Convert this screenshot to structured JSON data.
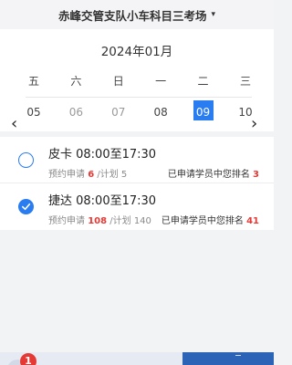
{
  "header": {
    "title": "赤峰交管支队小车科目三考场",
    "caret": "▾"
  },
  "calendar": {
    "month": "2024年01月",
    "weekdays": [
      "五",
      "六",
      "日",
      "一",
      "二",
      "三"
    ],
    "dates": [
      "05",
      "06",
      "07",
      "08",
      "09",
      "10"
    ],
    "selected_date": "09",
    "prev_arrow": "‹",
    "next_arrow": "›"
  },
  "slots": [
    {
      "name": "皮卡 08:00至17:30",
      "applied_label": "预约申请",
      "applied_value": "6",
      "plan_label": "/计划",
      "plan_value": "5",
      "rank_label": "已申请学员中您排名",
      "rank_value": "3",
      "checked": false
    },
    {
      "name": "捷达 08:00至17:30",
      "applied_label": "预约申请",
      "applied_value": "108",
      "plan_label": "/计划",
      "plan_value": "140",
      "rank_label": "已申请学员中您排名",
      "rank_value": "41",
      "checked": true
    }
  ],
  "bottom": {
    "badge_count": "1"
  },
  "colors": {
    "accent": "#2a7df0",
    "highlight": "#e53935",
    "bottom_button": "#2b63b6"
  }
}
